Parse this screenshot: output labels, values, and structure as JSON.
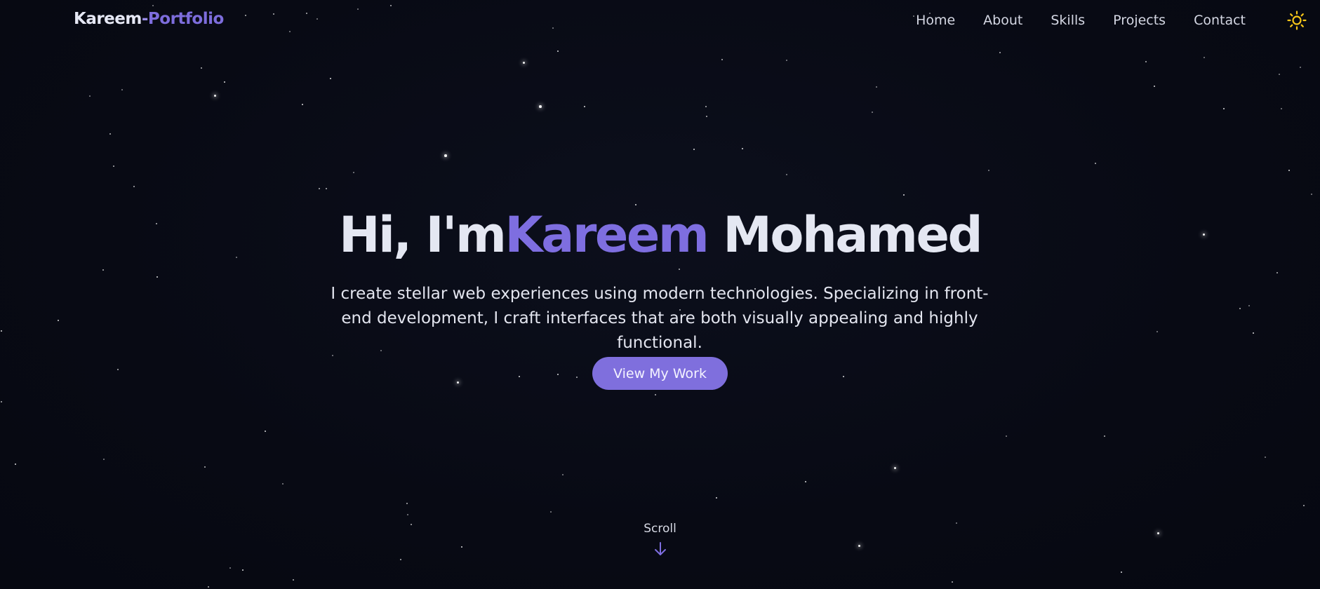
{
  "nav": {
    "brand_first": "Kareem",
    "brand_sep": "-",
    "brand_second": "Portfolio",
    "links": [
      "Home",
      "About",
      "Skills",
      "Projects",
      "Contact"
    ],
    "theme_icon": "sun-icon"
  },
  "hero": {
    "title_prefix": "Hi, I'm",
    "title_accent": "Kareem",
    "title_suffix": "Mohamed",
    "subtitle": "I create stellar web experiences using modern technologies. Specializing in front-end development, I craft interfaces that are both visually appealing and highly functional.",
    "cta_label": "View My Work"
  },
  "scroll": {
    "label": "Scroll",
    "icon": "arrow-down-icon"
  },
  "colors": {
    "background": "#080a14",
    "accent": "#7e6ee0",
    "text": "#e4e7f2",
    "sun": "#f5c518"
  }
}
